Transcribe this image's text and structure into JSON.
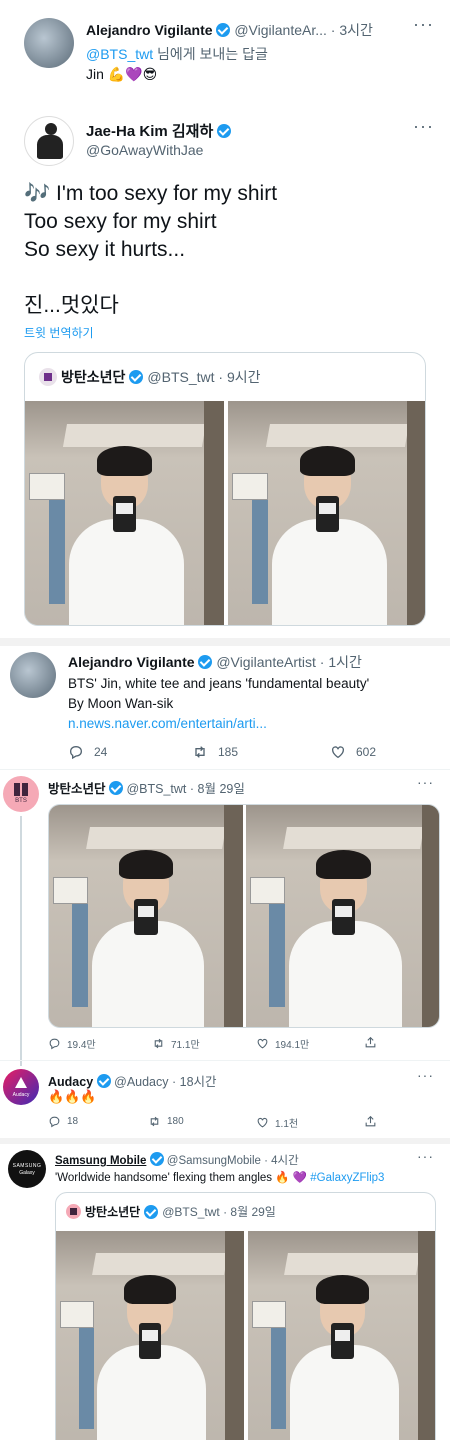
{
  "reply": {
    "author": "Alejandro Vigilante",
    "handle": "@VigilanteAr...",
    "time": "· 3시간",
    "mention": "@BTS_twt",
    "reply_text": "님에게 보내는 답글",
    "body": "Jin 💪💜😎"
  },
  "main": {
    "author": "Jae-Ha Kim 김재하",
    "handle": "@GoAwayWithJae",
    "line1_emoji": "🎶",
    "line1": " I'm too sexy for my shirt",
    "line2": "Too sexy for my shirt",
    "line3": "So sexy it hurts...",
    "line4": "진...멋있다",
    "translate": "트윗 번역하기",
    "quote": {
      "author": "방탄소년단",
      "handle": "@BTS_twt · 9시간"
    }
  },
  "tweet2": {
    "author": "Alejandro Vigilante",
    "handle": "@VigilanteArtist · 1시간",
    "body1": "BTS' Jin, white tee and jeans 'fundamental beauty'",
    "body2": "By Moon Wan-sik",
    "link": "n.news.naver.com/entertain/arti...",
    "replies": "24",
    "retweets": "185",
    "likes": "602"
  },
  "tweet3": {
    "author": "방탄소년단",
    "handle": "@BTS_twt · 8월 29일",
    "avatar_text": "BTS",
    "replies": "19.4만",
    "retweets": "71.1만",
    "likes": "194.1만"
  },
  "tweet4": {
    "author": "Audacy",
    "handle": "@Audacy · 18시간",
    "avatar_text": "Audacy",
    "body": "🔥🔥🔥",
    "replies": "18",
    "retweets": "180",
    "likes": "1.1천"
  },
  "tweet5": {
    "author": "Samsung Mobile",
    "handle": "@SamsungMobile · 4시간",
    "avatar_line1": "SAMSUNG",
    "avatar_line2": "Galaxy",
    "body": "'Worldwide handsome' flexing them angles 🔥 💜",
    "hashtag": "#GalaxyZFlip3",
    "quote": {
      "author": "방탄소년단",
      "handle": "@BTS_twt · 8월 29일"
    }
  },
  "colors": {
    "accent": "#1d9bf0",
    "text": "#0f1419",
    "secondary": "#536471",
    "divider": "#eff3f4",
    "band": "#f7f9f9"
  }
}
